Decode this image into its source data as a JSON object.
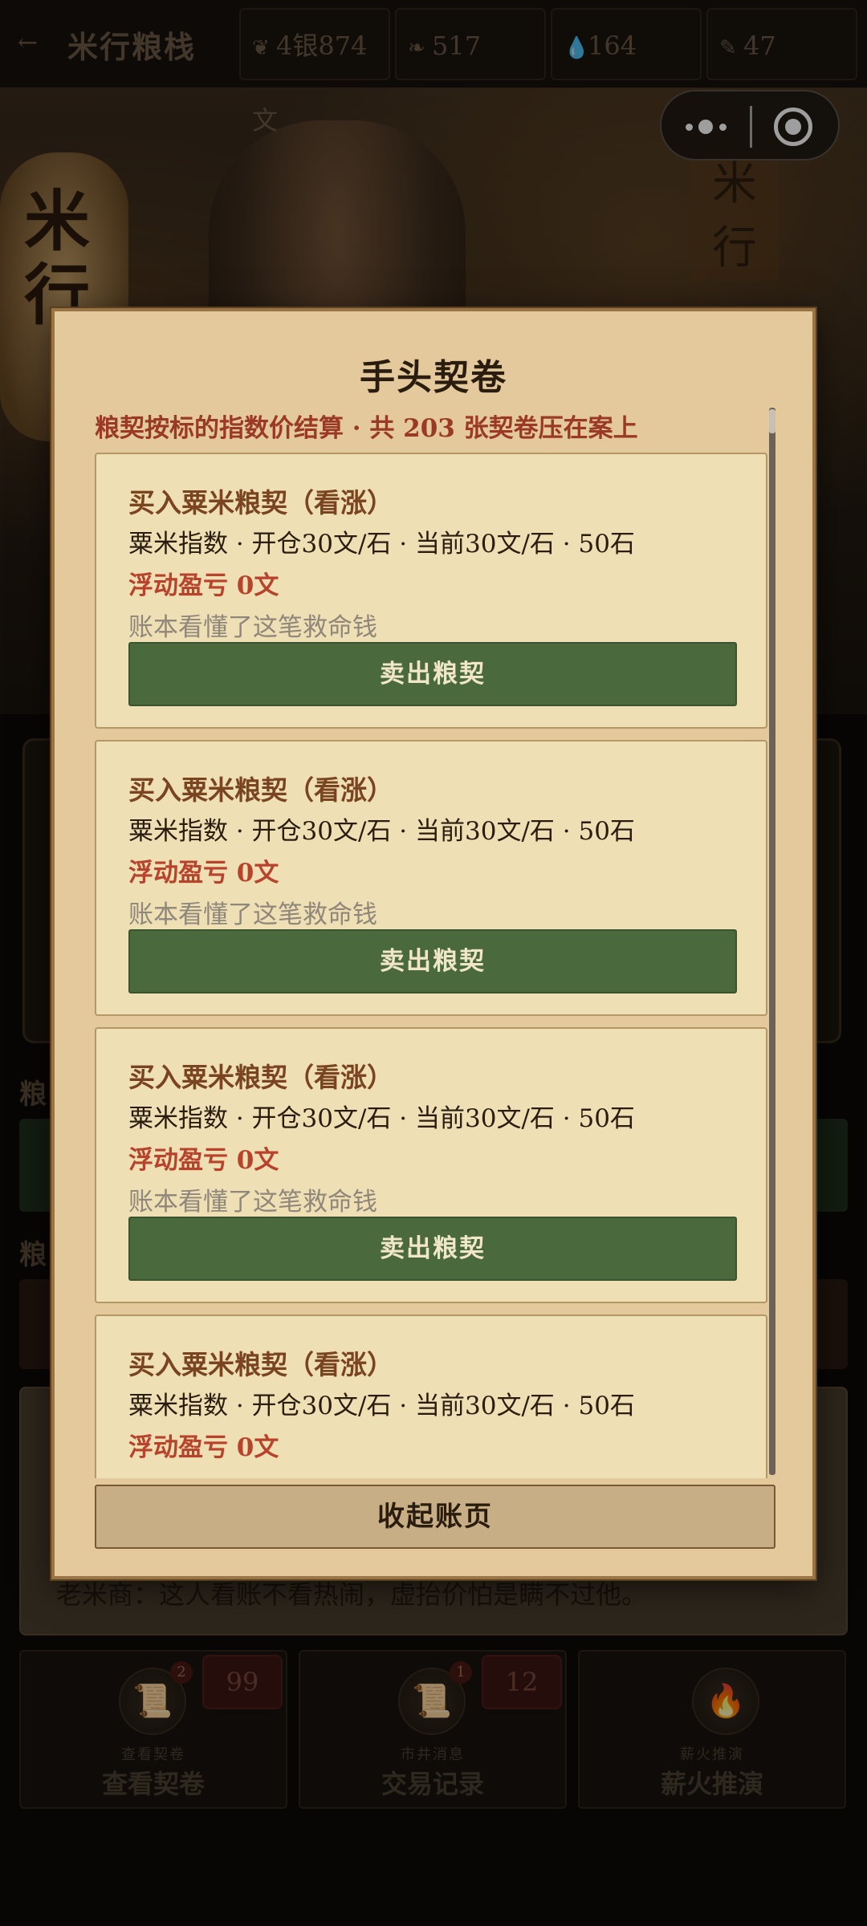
{
  "topbar": {
    "back_icon": "←",
    "title": "米行粮栈",
    "stats": [
      {
        "icon": "silver-icon",
        "glyph": "❦",
        "value": "4银874文"
      },
      {
        "icon": "grain-icon",
        "glyph": "❧",
        "value": "517"
      },
      {
        "icon": "water-icon",
        "glyph": "💧",
        "value": "164"
      },
      {
        "icon": "feather-icon",
        "glyph": "✎",
        "value": "47"
      }
    ]
  },
  "background": {
    "lantern_text": "米行",
    "sign_text": "米行",
    "label_1": "粮",
    "label_2": "粮",
    "dialog_text": "老米商：这人看账不看热闹，虚抬价怕是瞒不过他。"
  },
  "bottom_tabs": [
    {
      "sub": "查看契卷",
      "name": "查看契卷",
      "badge": "2",
      "count": "99",
      "glyph": "📜"
    },
    {
      "sub": "市井消息",
      "name": "交易记录",
      "badge": "1",
      "count": "12",
      "glyph": "📜"
    },
    {
      "sub": "薪火推演",
      "name": "薪火推演",
      "badge": "",
      "count": "",
      "glyph": "🔥"
    }
  ],
  "modal": {
    "title": "手头契卷",
    "summary": "粮契按标的指数价结算 · 共 203 张契卷压在案上",
    "contracts": [
      {
        "title": "买入粟米粮契（看涨）",
        "detail": "粟米指数 · 开仓30文/石 · 当前30文/石 · 50石",
        "pnl": "浮动盈亏 0文",
        "note": "账本看懂了这笔救命钱",
        "button": "卖出粮契"
      },
      {
        "title": "买入粟米粮契（看涨）",
        "detail": "粟米指数 · 开仓30文/石 · 当前30文/石 · 50石",
        "pnl": "浮动盈亏 0文",
        "note": "账本看懂了这笔救命钱",
        "button": "卖出粮契"
      },
      {
        "title": "买入粟米粮契（看涨）",
        "detail": "粟米指数 · 开仓30文/石 · 当前30文/石 · 50石",
        "pnl": "浮动盈亏 0文",
        "note": "账本看懂了这笔救命钱",
        "button": "卖出粮契"
      },
      {
        "title": "买入粟米粮契（看涨）",
        "detail": "粟米指数 · 开仓30文/石 · 当前30文/石 · 50石",
        "pnl": "浮动盈亏 0文",
        "note": "",
        "button": ""
      }
    ],
    "collapse_label": "收起账页"
  },
  "colors": {
    "accent_green": "#4a6a3e",
    "pnl_red": "#b8432d",
    "title_brown": "#7a4420",
    "parchment": "#e3c99b"
  }
}
